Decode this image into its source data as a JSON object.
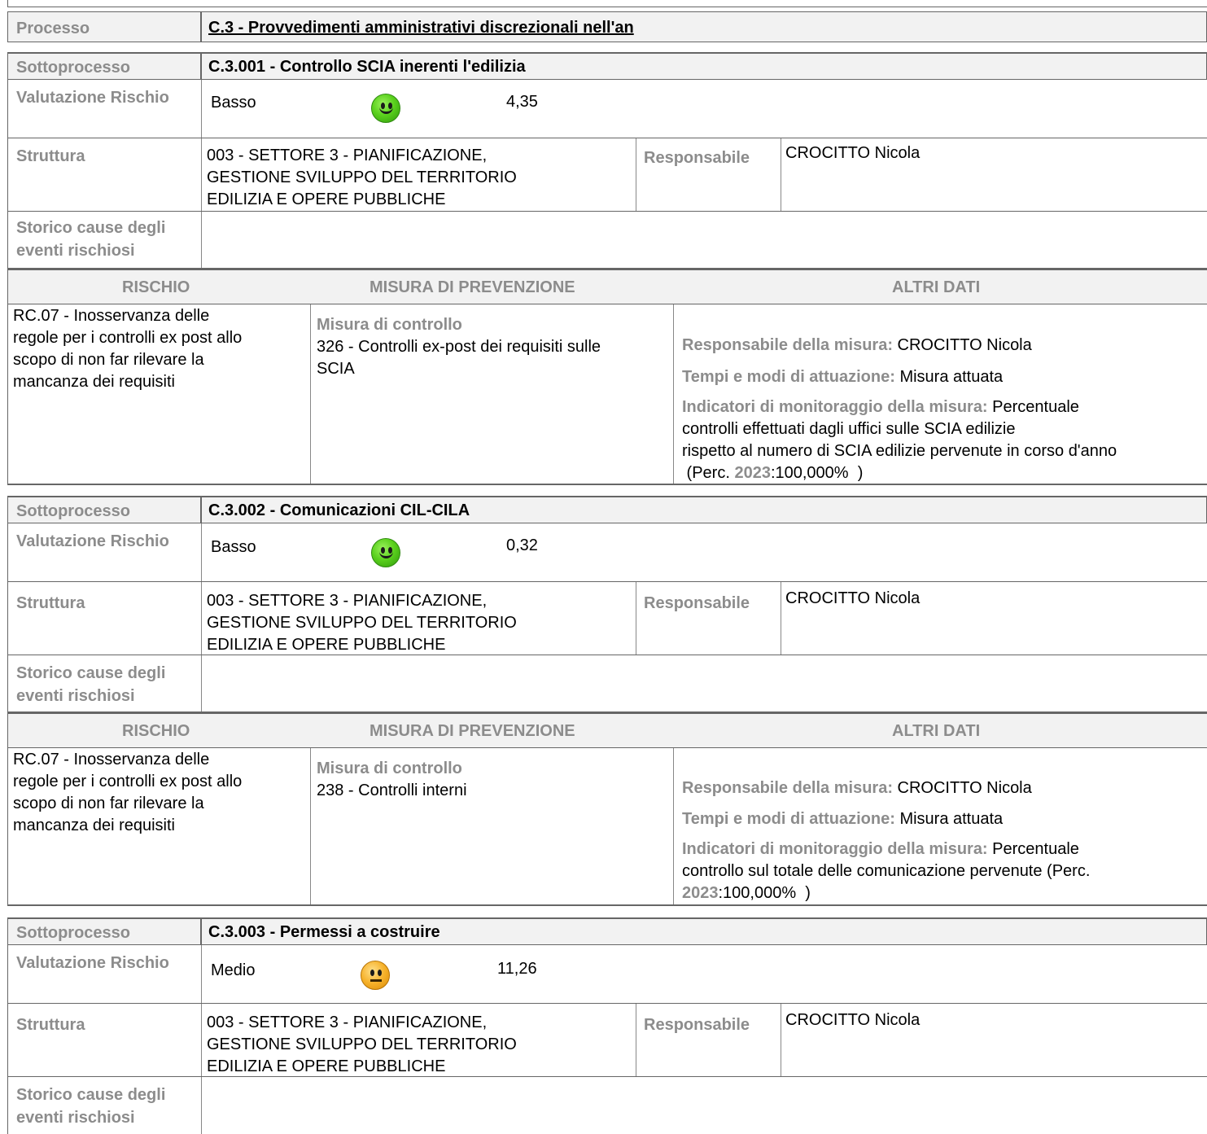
{
  "processo": {
    "label": "Processo",
    "value": "C.3 - Provvedimenti amministrativi discrezionali nell'an"
  },
  "labels": {
    "sottoprocesso": "Sottoprocesso",
    "valutazione": "Valutazione Rischio",
    "struttura": "Struttura",
    "responsabile": "Responsabile",
    "storico_line1": "Storico cause degli",
    "storico_line2": "eventi rischiosi",
    "col_rischio": "RISCHIO",
    "col_misura": "MISURA DI PREVENZIONE",
    "col_altri": "ALTRI DATI",
    "resp_misura": "Responsabile della misura:",
    "tempi": "Tempi e modi di attuazione:",
    "indicatori": "Indicatori di monitoraggio della misura:"
  },
  "sottoprocessi": [
    {
      "title": "C.3.001 - Controllo SCIA inerenti l'edilizia",
      "livello": "Basso",
      "icon": "smiley-happy-icon",
      "score": "4,35",
      "struttura": [
        "003 - SETTORE 3 - PIANIFICAZIONE,",
        "GESTIONE SVILUPPO DEL TERRITORIO",
        "EDILIZIA E OPERE PUBBLICHE"
      ],
      "responsabile": "CROCITTO Nicola",
      "rischio": [
        "RC.07 - Inosservanza delle",
        "regole per i controlli ex post allo",
        "scopo di non far rilevare la",
        "mancanza dei requisiti"
      ],
      "misura_tipo": "Misura di controllo",
      "misura": [
        "326 - Controlli ex-post dei requisiti sulle",
        "SCIA"
      ],
      "resp_misura": "CROCITTO Nicola",
      "tempi": "Misura attuata",
      "indicatori_first": "Percentuale",
      "indicatori_lines": [
        "controlli effettuati dagli uffici sulle SCIA edilizie",
        "rispetto al numero di SCIA edilizie pervenute in corso d'anno"
      ],
      "perc_prefix": " (Perc. ",
      "perc_year": "2023",
      "perc_value": ":100,000%  )"
    },
    {
      "title": "C.3.002 - Comunicazioni CIL-CILA",
      "livello": "Basso",
      "icon": "smiley-happy-icon",
      "score": "0,32",
      "struttura": [
        "003 - SETTORE 3 - PIANIFICAZIONE,",
        "GESTIONE SVILUPPO DEL TERRITORIO",
        "EDILIZIA E OPERE PUBBLICHE"
      ],
      "responsabile": "CROCITTO Nicola",
      "rischio": [
        "RC.07 - Inosservanza delle",
        "regole per i controlli ex post allo",
        "scopo di non far rilevare la",
        "mancanza dei requisiti"
      ],
      "misura_tipo": "Misura di controllo",
      "misura": [
        "238 - Controlli interni"
      ],
      "resp_misura": "CROCITTO Nicola",
      "tempi": "Misura attuata",
      "indicatori_first": "Percentuale",
      "indicatori_lines": [
        "controllo sul totale delle comunicazione pervenute (Perc."
      ],
      "perc_prefix": "",
      "perc_year": "2023",
      "perc_value": ":100,000%  )"
    },
    {
      "title": "C.3.003 - Permessi a costruire",
      "livello": "Medio",
      "icon": "smiley-neutral-icon",
      "score": "11,26",
      "struttura": [
        "003 - SETTORE 3 - PIANIFICAZIONE,",
        "GESTIONE SVILUPPO DEL TERRITORIO",
        "EDILIZIA E OPERE PUBBLICHE"
      ],
      "responsabile": "CROCITTO Nicola"
    }
  ]
}
